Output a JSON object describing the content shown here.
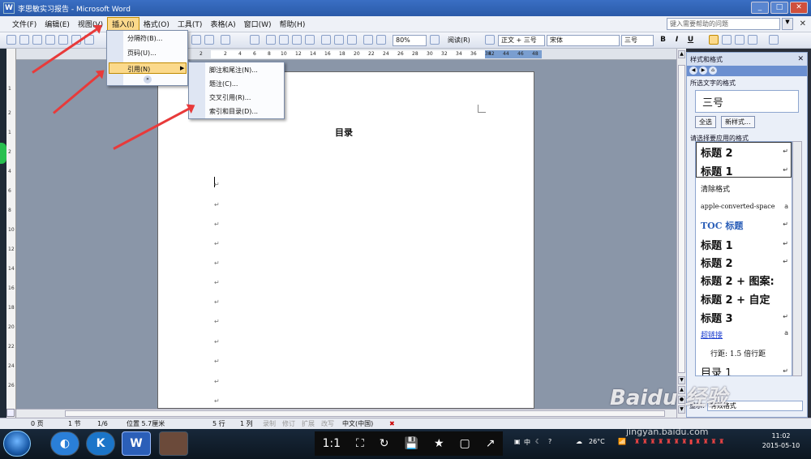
{
  "window": {
    "title": "李思敏实习报告 - Microsoft Word",
    "app_icon": "W",
    "min": "_",
    "max": "□",
    "close": "✕"
  },
  "menubar": {
    "items": [
      "文件(F)",
      "编辑(E)",
      "视图(V)",
      "插入(I)",
      "格式(O)",
      "工具(T)",
      "表格(A)",
      "窗口(W)",
      "帮助(H)"
    ],
    "active_index": 3,
    "help_placeholder": "键入需要帮助的问题",
    "close": "✕"
  },
  "toolbar": {
    "zoom": "80%",
    "read_label": "阅读(R)",
    "style": "正文 + 三号",
    "font": "宋体",
    "size": "三号",
    "bold": "B",
    "italic": "I",
    "underline": "U"
  },
  "insert_menu": {
    "items": [
      "分隔符(B)...",
      "页码(U)...",
      "引用(N)"
    ],
    "highlighted": "引用(N)",
    "expand": "»"
  },
  "reference_submenu": {
    "items": [
      "脚注和尾注(N)...",
      "题注(C)...",
      "交叉引用(R)...",
      "索引和目录(D)..."
    ]
  },
  "ruler": {
    "top_ticks": [
      "2",
      "2",
      "4",
      "6",
      "8",
      "10",
      "12",
      "14",
      "16",
      "18",
      "20",
      "22",
      "24",
      "26",
      "28",
      "30",
      "32",
      "34",
      "36",
      "38",
      "42",
      "44",
      "46",
      "48"
    ],
    "left_ticks": [
      "1",
      "2",
      "1",
      "2",
      "4",
      "6",
      "8",
      "10",
      "12",
      "14",
      "16",
      "18",
      "20",
      "22",
      "24",
      "26"
    ]
  },
  "document": {
    "heading": "目录",
    "para_mark": "↵"
  },
  "task_pane": {
    "title": "样式和格式",
    "close": "✕",
    "selected_label": "所选文字的格式",
    "selected_value": "三号",
    "select_all": "全选",
    "new_style": "新样式...",
    "apply_label": "请选择要应用的格式",
    "styles": [
      "标题 2",
      "标题 1",
      "清除格式",
      "apple-converted-space",
      "TOC 标题",
      "标题 1",
      "标题 2",
      "标题 2 + 图案:",
      "标题 2 + 自定",
      "标题 3",
      "超链接",
      "行距: 1.5 倍行距",
      "目录 1"
    ],
    "show_label": "显示:",
    "show_value": "有效格式"
  },
  "status": {
    "page": "0 页",
    "section": "1 节",
    "pages": "1/6",
    "position": "位置 5.7厘米",
    "line": "5 行",
    "column": "1 列",
    "rec": "录制",
    "trk": "修订",
    "ext": "扩展",
    "ovr": "改写",
    "lang": "中文(中国)"
  },
  "taskbar": {
    "mobile_controls": [
      "1:1",
      "⛶",
      "↻",
      "💾",
      "★",
      "▢",
      "↗"
    ],
    "tray_lang": "中",
    "weather": "26°C",
    "time": "11:02",
    "date": "2015-05-10"
  },
  "watermark": {
    "brand": "Baidu 经验",
    "url": "jingyan.baidu.com"
  },
  "colors": {
    "accent": "#fbd98b",
    "arrow": "#e83a3a",
    "titlebar": "#2a5aa8"
  }
}
